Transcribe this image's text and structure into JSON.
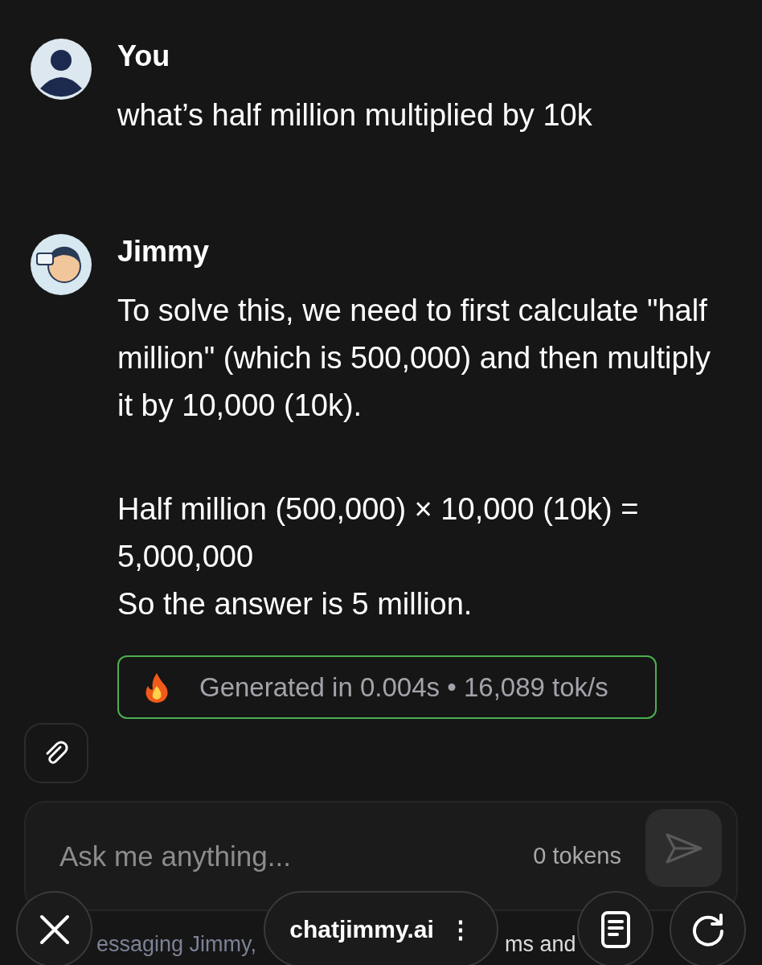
{
  "messages": [
    {
      "kind": "user",
      "author": "You",
      "paragraphs": [
        "what’s half million multiplied by 10k"
      ]
    },
    {
      "kind": "bot",
      "author": "Jimmy",
      "paragraphs": [
        "To solve this, we need to first calculate \"half million\" (which is 500,000) and then multiply it by 10,000 (10k).",
        "Half million (500,000) × 10,000 (10k) = 5,000,000",
        "So the answer is 5 million."
      ]
    }
  ],
  "stats": {
    "text": "Generated in 0.004s • 16,089 tok/s"
  },
  "composer": {
    "placeholder": "Ask me anything...",
    "token_count": "0 tokens"
  },
  "footer": [
    "essaging Jimmy,",
    "ms and"
  ],
  "browser_bar": {
    "url": "chatjimmy.ai",
    "more": "⋮"
  }
}
